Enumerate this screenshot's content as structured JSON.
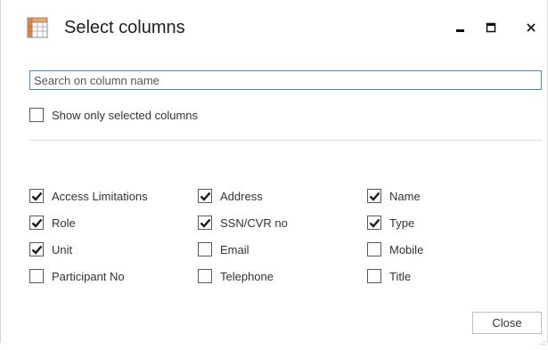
{
  "window": {
    "title": "Select columns",
    "icon": "table-grid-icon",
    "controls": {
      "minimize": "minimize-icon",
      "maximize": "maximize-icon",
      "close": "close-icon"
    }
  },
  "search": {
    "placeholder": "Search on column name",
    "value": ""
  },
  "filter": {
    "label": "Show only selected columns",
    "checked": false
  },
  "columns": [
    [
      {
        "label": "Access Limitations",
        "checked": true
      },
      {
        "label": "Role",
        "checked": true
      },
      {
        "label": "Unit",
        "checked": true
      },
      {
        "label": "Participant No",
        "checked": false
      }
    ],
    [
      {
        "label": "Address",
        "checked": true
      },
      {
        "label": "SSN/CVR no",
        "checked": true
      },
      {
        "label": "Email",
        "checked": false
      },
      {
        "label": "Telephone",
        "checked": false
      }
    ],
    [
      {
        "label": "Name",
        "checked": true
      },
      {
        "label": "Type",
        "checked": true
      },
      {
        "label": "Mobile",
        "checked": false
      },
      {
        "label": "Title",
        "checked": false
      }
    ]
  ],
  "footer": {
    "close_label": "Close"
  },
  "colors": {
    "accent": "#4a8ad4",
    "icon_orange": "#e8823a",
    "text": "#333333"
  }
}
